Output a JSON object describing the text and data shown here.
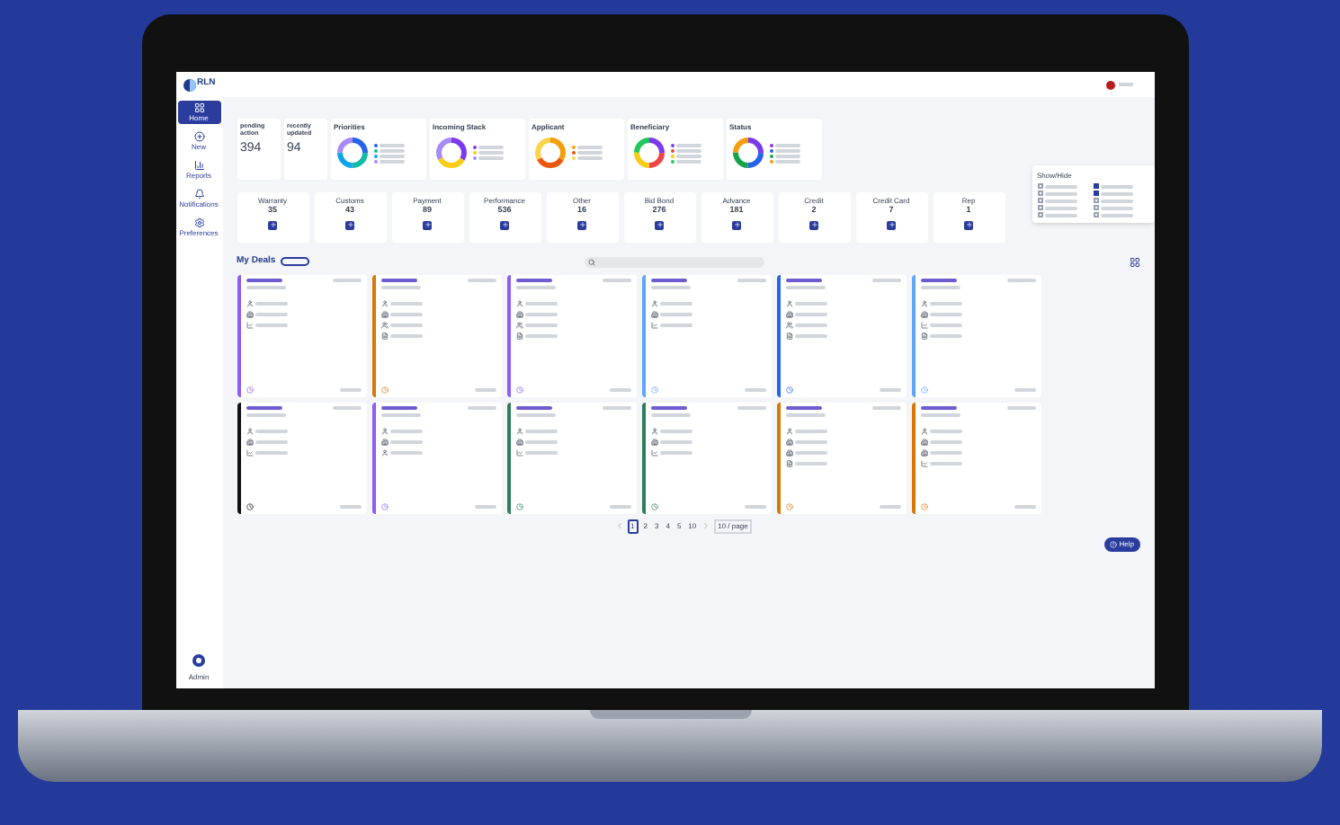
{
  "app": {
    "logo": "RLN"
  },
  "sidebar": {
    "items": [
      {
        "label": "Home",
        "kind": "grid",
        "selected": true
      },
      {
        "label": "New",
        "kind": "plus",
        "selected": false
      },
      {
        "label": "Reports",
        "kind": "bars",
        "selected": false
      },
      {
        "label": "Notifications",
        "kind": "bell",
        "selected": false
      },
      {
        "label": "Preferences",
        "kind": "gear",
        "selected": false
      }
    ],
    "footer": {
      "label": "Admin"
    }
  },
  "summary": [
    {
      "label": "pending action",
      "value": "394"
    },
    {
      "label": "recently updated",
      "value": "94"
    }
  ],
  "donuts": [
    {
      "title": "Priorities",
      "legend": [
        {
          "color": "#2563eb"
        },
        {
          "color": "#14b8a6"
        },
        {
          "color": "#0ea5e9"
        },
        {
          "color": "#a78bfa"
        }
      ]
    },
    {
      "title": "Incoming Stack",
      "legend": [
        {
          "color": "#7c3aed"
        },
        {
          "color": "#facc15"
        },
        {
          "color": "#a78bfa"
        }
      ]
    },
    {
      "title": "Applicant",
      "legend": [
        {
          "color": "#f59e0b"
        },
        {
          "color": "#ea580c"
        },
        {
          "color": "#fcd34d"
        }
      ]
    },
    {
      "title": "Beneficiary",
      "legend": [
        {
          "color": "#7c3aed"
        },
        {
          "color": "#ef4444"
        },
        {
          "color": "#facc15"
        },
        {
          "color": "#22c55e"
        }
      ]
    },
    {
      "title": "Status",
      "legend": [
        {
          "color": "#7c3aed"
        },
        {
          "color": "#2563eb"
        },
        {
          "color": "#16a34a"
        },
        {
          "color": "#f59e0b"
        }
      ]
    }
  ],
  "categories": [
    {
      "label": "Warranty",
      "count": "35"
    },
    {
      "label": "Customs",
      "count": "43"
    },
    {
      "label": "Payment",
      "count": "89"
    },
    {
      "label": "Performance",
      "count": "536"
    },
    {
      "label": "Other",
      "count": "16"
    },
    {
      "label": "Bid Bond",
      "count": "276"
    },
    {
      "label": "Advance",
      "count": "181"
    },
    {
      "label": "Credit",
      "count": "2"
    },
    {
      "label": "Credit Card",
      "count": "7"
    },
    {
      "label": "Rep",
      "count": "1"
    }
  ],
  "column_menu": {
    "title": "Show/Hide",
    "options": [
      {
        "checked": false
      },
      {
        "checked": true
      },
      {
        "checked": false
      },
      {
        "checked": true
      },
      {
        "checked": false
      },
      {
        "checked": false
      },
      {
        "checked": false
      },
      {
        "checked": false
      },
      {
        "checked": false
      },
      {
        "checked": false
      }
    ]
  },
  "deals": {
    "title": "My Deals",
    "cards": [
      {
        "color": "#8b5cf6",
        "details": [
          {
            "kind": "person"
          },
          {
            "kind": "building"
          },
          {
            "kind": "chart"
          }
        ]
      },
      {
        "color": "#d97706",
        "details": [
          {
            "kind": "person"
          },
          {
            "kind": "building"
          },
          {
            "kind": "people"
          },
          {
            "kind": "doc"
          }
        ]
      },
      {
        "color": "#8b5cf6",
        "details": [
          {
            "kind": "person"
          },
          {
            "kind": "building"
          },
          {
            "kind": "people"
          },
          {
            "kind": "doc"
          }
        ]
      },
      {
        "color": "#60a5fa",
        "details": [
          {
            "kind": "person"
          },
          {
            "kind": "building"
          },
          {
            "kind": "chart"
          }
        ]
      },
      {
        "color": "#2563eb",
        "details": [
          {
            "kind": "person"
          },
          {
            "kind": "building"
          },
          {
            "kind": "people"
          },
          {
            "kind": "doc"
          }
        ]
      },
      {
        "color": "#60a5fa",
        "details": [
          {
            "kind": "person"
          },
          {
            "kind": "building"
          },
          {
            "kind": "chart"
          },
          {
            "kind": "doc"
          }
        ]
      },
      {
        "color": "#111111",
        "details": [
          {
            "kind": "person"
          },
          {
            "kind": "building"
          },
          {
            "kind": "chart"
          }
        ]
      },
      {
        "color": "#8b5cf6",
        "details": [
          {
            "kind": "person"
          },
          {
            "kind": "building"
          },
          {
            "kind": "person"
          }
        ]
      },
      {
        "color": "#2f7d5b",
        "details": [
          {
            "kind": "person"
          },
          {
            "kind": "building"
          },
          {
            "kind": "chart"
          }
        ]
      },
      {
        "color": "#2f7d5b",
        "details": [
          {
            "kind": "person"
          },
          {
            "kind": "building"
          },
          {
            "kind": "chart"
          }
        ]
      },
      {
        "color": "#d97706",
        "details": [
          {
            "kind": "person"
          },
          {
            "kind": "building"
          },
          {
            "kind": "building"
          },
          {
            "kind": "doc"
          }
        ]
      },
      {
        "color": "#d97706",
        "details": [
          {
            "kind": "person"
          },
          {
            "kind": "building"
          },
          {
            "kind": "building"
          },
          {
            "kind": "chart"
          }
        ]
      }
    ]
  },
  "pagination": {
    "pages": [
      {
        "label": "1",
        "selected": true
      },
      {
        "label": "2",
        "selected": false
      },
      {
        "label": "3",
        "selected": false
      },
      {
        "label": "4",
        "selected": false
      },
      {
        "label": "5",
        "selected": false
      },
      {
        "label": "10",
        "selected": false
      }
    ],
    "page_size": "10 / page"
  },
  "help": {
    "label": "Help"
  }
}
